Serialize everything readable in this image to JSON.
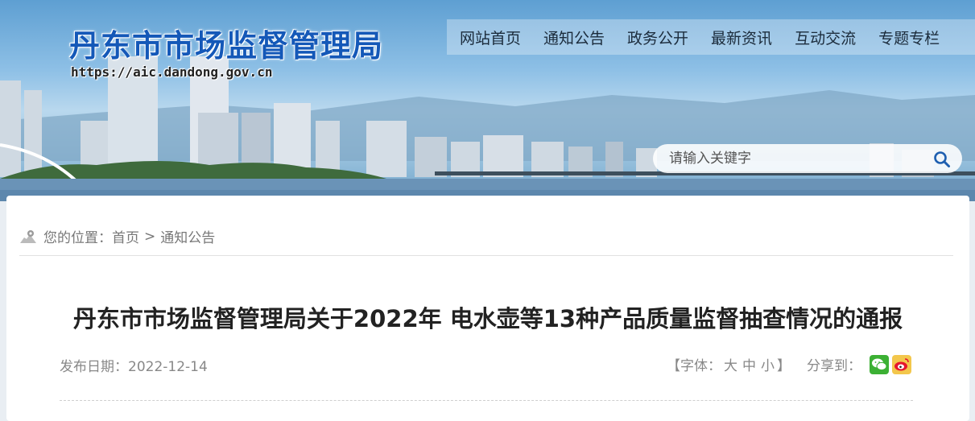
{
  "header": {
    "site_title": "丹东市市场监督管理局",
    "site_url": "https://aic.dandong.gov.cn"
  },
  "nav": {
    "items": [
      "网站首页",
      "通知公告",
      "政务公开",
      "最新资讯",
      "互动交流",
      "专题专栏"
    ]
  },
  "search": {
    "placeholder": "请输入关键字",
    "icon": "search-icon"
  },
  "breadcrumb": {
    "prefix": "您的位置：",
    "home": "首页",
    "separator": ">",
    "current": "通知公告",
    "icon": "location-map-icon"
  },
  "article": {
    "title": "丹东市市场监督管理局关于2022年 电水壶等13种产品质量监督抽查情况的通报",
    "date_label": "发布日期：",
    "date": "2022-12-14"
  },
  "tools": {
    "font_open": "【字体：",
    "font_large": "大",
    "font_medium": "中",
    "font_small": "小",
    "font_close": "】",
    "share_label": "分享到：",
    "share_icons": [
      "wechat-icon",
      "weibo-icon"
    ]
  },
  "colors": {
    "title_blue": "#1458b8",
    "wechat_green": "#3cb034",
    "weibo_bg": "#f3c74c"
  }
}
